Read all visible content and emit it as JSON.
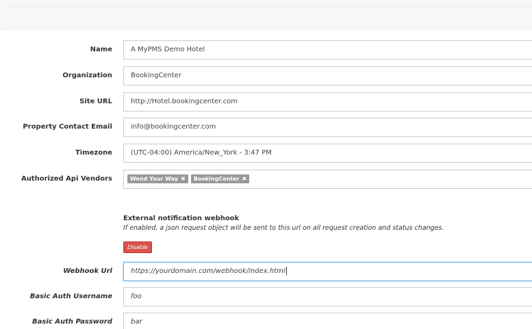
{
  "form": {
    "name": {
      "label": "Name",
      "value": "A MyPMS Demo Hotel"
    },
    "organization": {
      "label": "Organization",
      "value": "BookingCenter"
    },
    "site_url": {
      "label": "Site URL",
      "value": "http://Hotel.bookingcenter.com"
    },
    "contact_email": {
      "label": "Property Contact Email",
      "value": "info@bookingcenter.com"
    },
    "timezone": {
      "label": "Timezone",
      "value": "(UTC-04:00) America/New_York - 3:47 PM"
    },
    "api_vendors": {
      "label": "Authorized Api Vendors",
      "tags": [
        "Wend Your Way",
        "BookingCenter"
      ],
      "remove_glyph": "✖"
    }
  },
  "webhook": {
    "title": "External notification webhook",
    "description": "If enabled, a json request object will be sent to this url on all request creation and status changes.",
    "disable_label": "Disable",
    "url": {
      "label": "Webhook Url",
      "value": "https://yourdomain.com/webhook/index.html"
    },
    "username": {
      "label": "Basic Auth Username",
      "value": "foo"
    },
    "password": {
      "label": "Basic Auth Password",
      "value": "bar"
    }
  },
  "colors": {
    "danger": "#d9534f",
    "tag_bg": "#999999",
    "focus_border": "#66afe9"
  },
  "icons": {
    "tag_remove": "close-icon"
  }
}
